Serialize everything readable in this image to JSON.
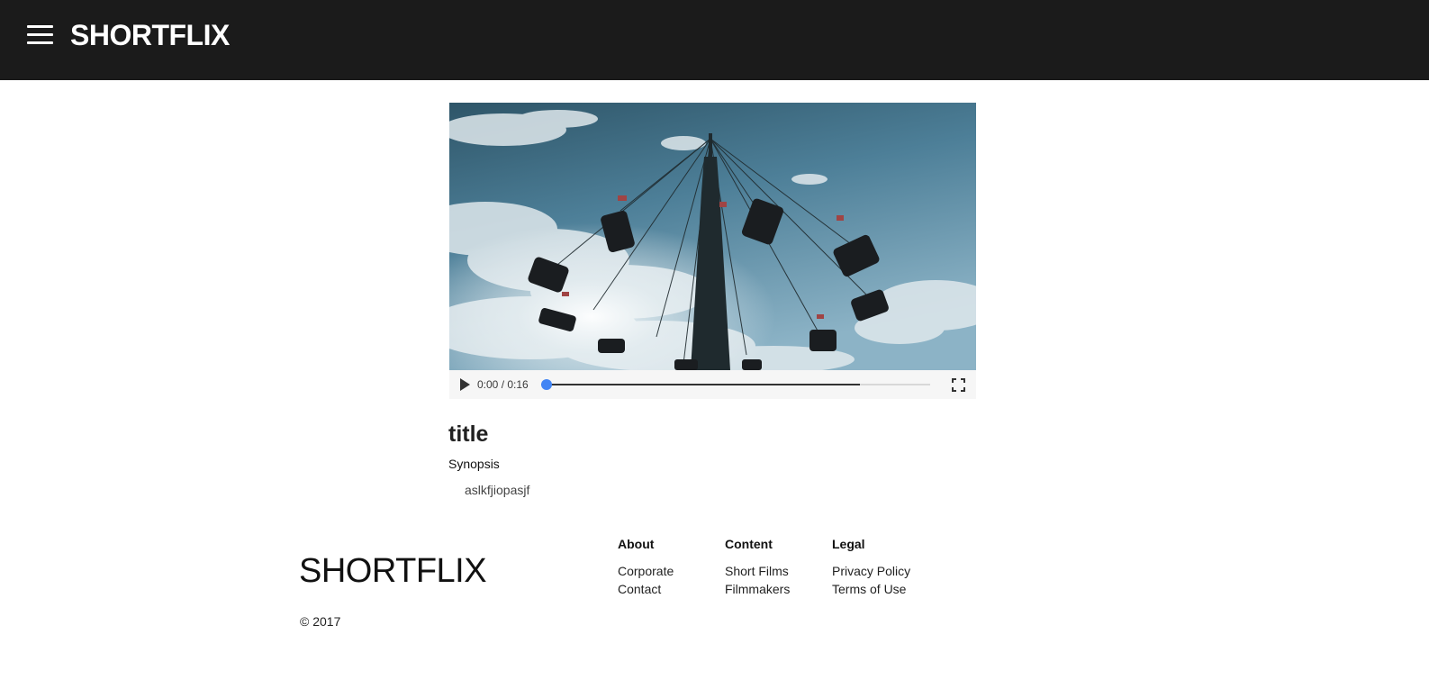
{
  "header": {
    "brand": "SHORTFLIX",
    "menu_icon": "hamburger-menu-icon",
    "background": "#1b1b1b"
  },
  "player": {
    "current_time": "0:00",
    "duration": "0:16",
    "time_display": "0:00 / 0:16",
    "progress_fraction": 0.0,
    "buffered_fraction": 0.82,
    "accent_color": "#4285f4",
    "play_icon": "play-icon",
    "fullscreen_icon": "fullscreen-icon"
  },
  "video": {
    "title": "title",
    "synopsis_label": "Synopsis",
    "synopsis": "aslkfjiopasjf"
  },
  "footer": {
    "brand": "SHORTFLIX",
    "copyright": "© 2017",
    "columns": [
      {
        "heading": "About",
        "links": [
          "Corporate",
          "Contact"
        ]
      },
      {
        "heading": "Content",
        "links": [
          "Short Films",
          "Filmmakers"
        ]
      },
      {
        "heading": "Legal",
        "links": [
          "Privacy Policy",
          "Terms of Use"
        ]
      }
    ]
  }
}
